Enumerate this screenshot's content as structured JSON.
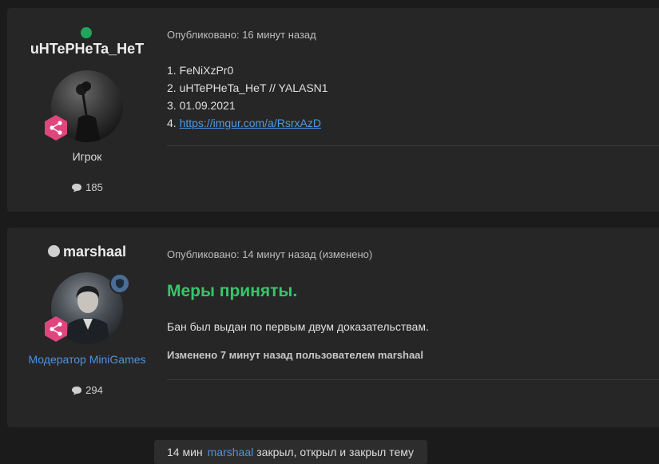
{
  "posts": [
    {
      "author": "uHTePHeTa_HeT",
      "online": true,
      "role_title": "Игрок",
      "post_count": "185",
      "meta": "Опубликовано: 16 минут назад",
      "lines": [
        "1. FeNiXzPr0",
        "2. uHTePHeTa_HeT // YALASN1",
        "3. 01.09.2021",
        "4. "
      ],
      "link": "https://imgur.com/a/RsrxAzD"
    },
    {
      "author": "marshaal",
      "online": false,
      "role_title": "Модератор MiniGames",
      "post_count": "294",
      "meta": "Опубликовано: 14 минут назад (изменено)",
      "headline": "Меры приняты.",
      "body": "Бан был выдан по первым двум доказательствам.",
      "edit_note": "Изменено 7 минут назад пользователем marshaal"
    }
  ],
  "event": {
    "time": "14 мин",
    "user": "marshaal",
    "action": "закрыл, открыл и закрыл тему"
  },
  "icons": {
    "online": "online-status-icon",
    "offline": "offline-status-icon",
    "role": "share-hexagon-icon",
    "moderator": "shield-icon",
    "comments": "comment-bubble-icon"
  },
  "colors": {
    "online": "#22a45d",
    "badge": "#e0457b",
    "moderator_title": "#4f93e0",
    "headline": "#35c76a",
    "link": "#4f9be8"
  }
}
